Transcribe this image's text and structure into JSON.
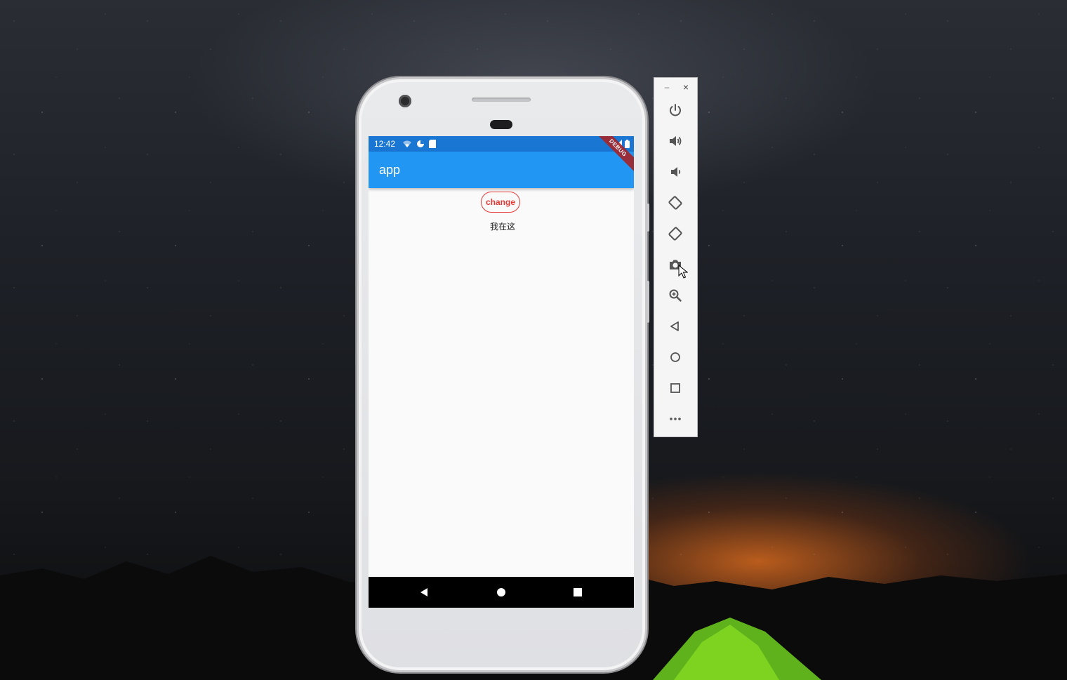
{
  "phone": {
    "status_bar": {
      "time": "12:42"
    },
    "app_bar": {
      "title": "app",
      "debug_banner": "DEBUG"
    },
    "content": {
      "change_button_label": "change",
      "text": "我在这"
    },
    "nav_bar": {
      "icons": [
        "back-icon",
        "home-icon",
        "recents-icon"
      ]
    }
  },
  "emulator_toolbar": {
    "window_controls": {
      "minimize": "–",
      "close": "×"
    },
    "buttons": [
      "power-icon",
      "volume-up-icon",
      "volume-down-icon",
      "rotate-left-icon",
      "rotate-right-icon",
      "camera-icon",
      "zoom-icon",
      "back-icon",
      "home-icon",
      "overview-icon",
      "more-icon"
    ]
  },
  "colors": {
    "status_bar": "#1976d2",
    "app_bar": "#2196f3",
    "accent_red": "#e53935",
    "screen_bg": "#fafafa",
    "debug_banner": "#a3262c"
  }
}
